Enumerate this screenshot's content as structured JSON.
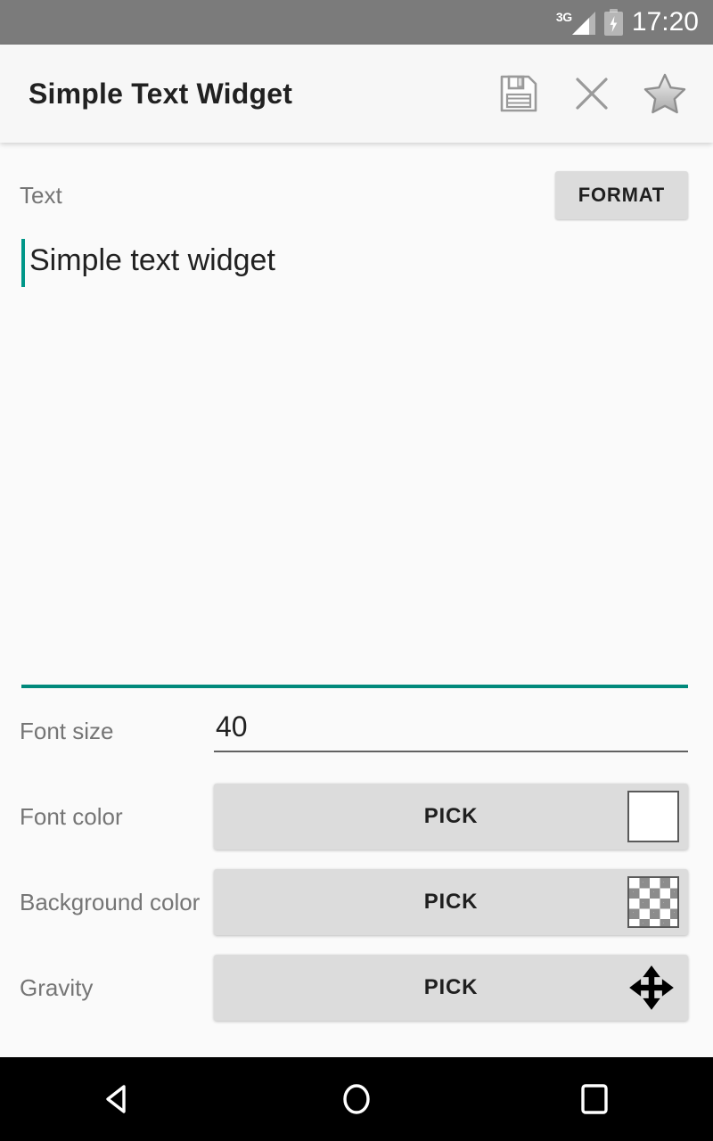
{
  "status_bar": {
    "network_label": "3G",
    "network_icon": "signal-3g-icon",
    "battery_icon": "battery-charging-icon",
    "time": "17:20"
  },
  "app_bar": {
    "title": "Simple Text Widget",
    "actions": [
      {
        "name": "save-icon",
        "label": "Save"
      },
      {
        "name": "close-icon",
        "label": "Close"
      },
      {
        "name": "star-icon",
        "label": "Favorite"
      }
    ]
  },
  "text_section": {
    "label": "Text",
    "format_label": "FORMAT",
    "value": "Simple text widget",
    "caret_color": "#009688",
    "underline_color": "#00897b"
  },
  "font_size": {
    "label": "Font size",
    "value": "40"
  },
  "font_color": {
    "label": "Font color",
    "pick_label": "PICK",
    "swatch_color": "#ffffff",
    "swatch_icon": "white-color-swatch"
  },
  "background_color": {
    "label": "Background color",
    "pick_label": "PICK",
    "swatch_icon": "transparent-checkerboard-swatch"
  },
  "gravity": {
    "label": "Gravity",
    "pick_label": "PICK",
    "icon": "move-arrows-icon"
  },
  "nav_bar": {
    "back": "back-triangle-icon",
    "home": "home-circle-icon",
    "recents": "recents-square-icon"
  },
  "colors": {
    "accent": "#00897b",
    "status_bar_bg": "#7b7b7b",
    "app_bar_bg": "#f7f7f7",
    "page_bg": "#fafafa",
    "button_bg": "#dcdcdc"
  }
}
